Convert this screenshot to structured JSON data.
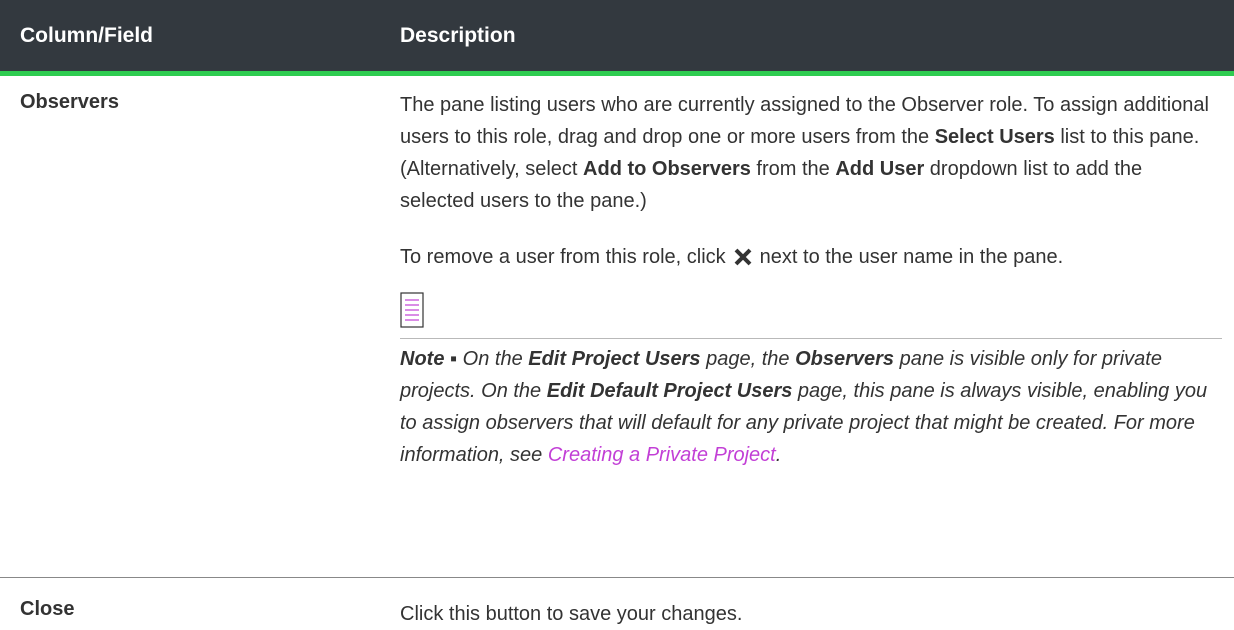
{
  "header": {
    "col1": "Column/Field",
    "col2": "Description"
  },
  "rows": [
    {
      "field": "Observers",
      "para1": [
        "The pane listing users who are currently assigned to the Observer role. To assign additional users to this role, drag and drop one or more users from the ",
        "Select Users",
        " list to this pane. (Alternatively, select ",
        "Add to Observers",
        " from the ",
        "Add User",
        " dropdown list to add the selected users to the pane.)"
      ],
      "para2": [
        "To remove a user from this role, click",
        "next to the user name in the pane."
      ],
      "note": [
        "Note ▪",
        " On the ",
        "Edit Project Users",
        " page, the ",
        "Observers",
        " pane is visible only for private projects. On the ",
        "Edit Default Project Users",
        " page, this pane is always visible, enabling you to assign observers that will default for any private project that might be created. For more information, see ",
        "Creating a Private Project",
        "."
      ]
    },
    {
      "field": "Close",
      "description": "Click this button to save your changes."
    }
  ],
  "colors": {
    "header_bg": "#33393f",
    "accent": "#2ecc50",
    "link": "#c23fd6"
  },
  "icons": [
    "close-x-icon",
    "note-icon"
  ]
}
